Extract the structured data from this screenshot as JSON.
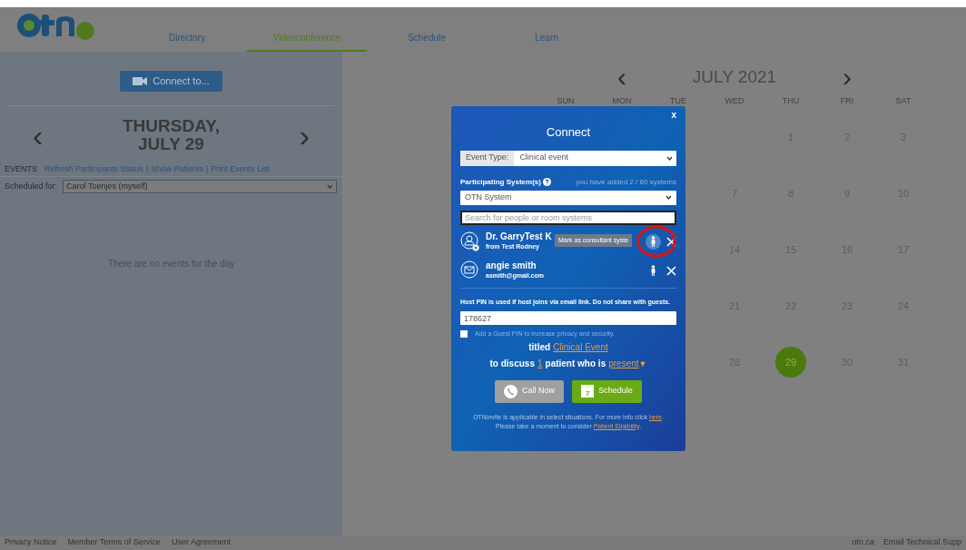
{
  "nav": {
    "tabs": [
      {
        "label": "Directory",
        "selected": false
      },
      {
        "label": "Videoconference",
        "selected": true
      },
      {
        "label": "Schedule",
        "selected": false
      },
      {
        "label": "Learn",
        "selected": false
      }
    ]
  },
  "left_panel": {
    "connect_button": "Connect to...",
    "prev": "‹",
    "next": "›",
    "date_line1": "THURSDAY,",
    "date_line2": "JULY 29",
    "events_label": "EVENTS",
    "link_separator": "|",
    "event_links": [
      {
        "label": "Refresh Participants Status"
      },
      {
        "label": "Show Patients"
      },
      {
        "label": "Print Events List"
      }
    ],
    "scheduled_label": "Scheduled for:",
    "scheduled_value": "Carol Toenjes (myself)",
    "empty_message": "There are no events for the day"
  },
  "calendar": {
    "prev": "‹",
    "title": "JULY 2021",
    "next": "›",
    "weekdays": [
      "SUN",
      "MON",
      "TUE",
      "WED",
      "THU",
      "FRI",
      "SAT"
    ],
    "weeks": [
      [
        {
          "kind": "blank"
        },
        {
          "kind": "blank"
        },
        {
          "kind": "blank"
        },
        {
          "kind": "blank"
        },
        {
          "kind": "day",
          "day": "1",
          "selected": false
        },
        {
          "kind": "day",
          "day": "2",
          "selected": false
        },
        {
          "kind": "day",
          "day": "3",
          "selected": false
        }
      ],
      [
        {
          "kind": "blank"
        },
        {
          "kind": "blank"
        },
        {
          "kind": "blank"
        },
        {
          "kind": "day",
          "day": "7",
          "selected": false
        },
        {
          "kind": "day",
          "day": "8",
          "selected": false
        },
        {
          "kind": "day",
          "day": "9",
          "selected": false
        },
        {
          "kind": "day",
          "day": "10",
          "selected": false
        }
      ],
      [
        {
          "kind": "blank"
        },
        {
          "kind": "blank"
        },
        {
          "kind": "blank"
        },
        {
          "kind": "day",
          "day": "14",
          "selected": false
        },
        {
          "kind": "day",
          "day": "15",
          "selected": false
        },
        {
          "kind": "day",
          "day": "16",
          "selected": false
        },
        {
          "kind": "day",
          "day": "17",
          "selected": false
        }
      ],
      [
        {
          "kind": "blank"
        },
        {
          "kind": "blank"
        },
        {
          "kind": "blank"
        },
        {
          "kind": "day",
          "day": "21",
          "selected": false
        },
        {
          "kind": "day",
          "day": "22",
          "selected": false
        },
        {
          "kind": "day",
          "day": "23",
          "selected": false
        },
        {
          "kind": "day",
          "day": "24",
          "selected": false
        }
      ],
      [
        {
          "kind": "blank"
        },
        {
          "kind": "blank"
        },
        {
          "kind": "blank"
        },
        {
          "kind": "day",
          "day": "28",
          "selected": false
        },
        {
          "kind": "day",
          "day": "29",
          "selected": true
        },
        {
          "kind": "day",
          "day": "30",
          "selected": false
        },
        {
          "kind": "day",
          "day": "31",
          "selected": false
        }
      ]
    ]
  },
  "dialog": {
    "close": "x",
    "title": "Connect",
    "event_type_label": "Event Type:",
    "event_type_value": "Clinical event",
    "participants_label": "Participating System(s)",
    "participants_count": "you have added 2 / 60 systems",
    "system_value": "OTN System",
    "search_placeholder": "Search for people or room systems",
    "participants": [
      {
        "kind": "person",
        "name": "Dr. GarryTest K",
        "detail": "from Test Rodney",
        "tooltip": "Mark as consultant syste",
        "highlighted": true
      },
      {
        "kind": "email",
        "name": "angie smith",
        "detail": "asmith@gmail.com",
        "highlighted": false
      }
    ],
    "pin_label": "Host PIN is used if host joins via email link. Do not share with guests.",
    "pin_value": "178627",
    "guest_pin_label": "Add a Guest PIN to increase privacy and security.",
    "guest_pin_checked": false,
    "titled_label": "titled",
    "title_link": "Clinical Event",
    "discuss_label": "to discuss",
    "patient_count": "1",
    "patient_label": "patient who is",
    "presence_link": "present",
    "presence_caret": "▼",
    "call_button": "Call Now",
    "schedule_button": "Schedule",
    "schedule_icon_day": "7",
    "notes": [
      {
        "before": "OTNinvite is applicable in select situations. For more info click ",
        "link": "here",
        "after": "."
      },
      {
        "before": "Please take a moment to consider ",
        "link": "Patient Eligibility",
        "after": "."
      }
    ]
  },
  "footer": {
    "left_links": [
      "Privacy Notice",
      "Member Terms of Service",
      "User Agreement"
    ],
    "right_links": [
      "otn.ca",
      "Email Technical Supp"
    ]
  }
}
